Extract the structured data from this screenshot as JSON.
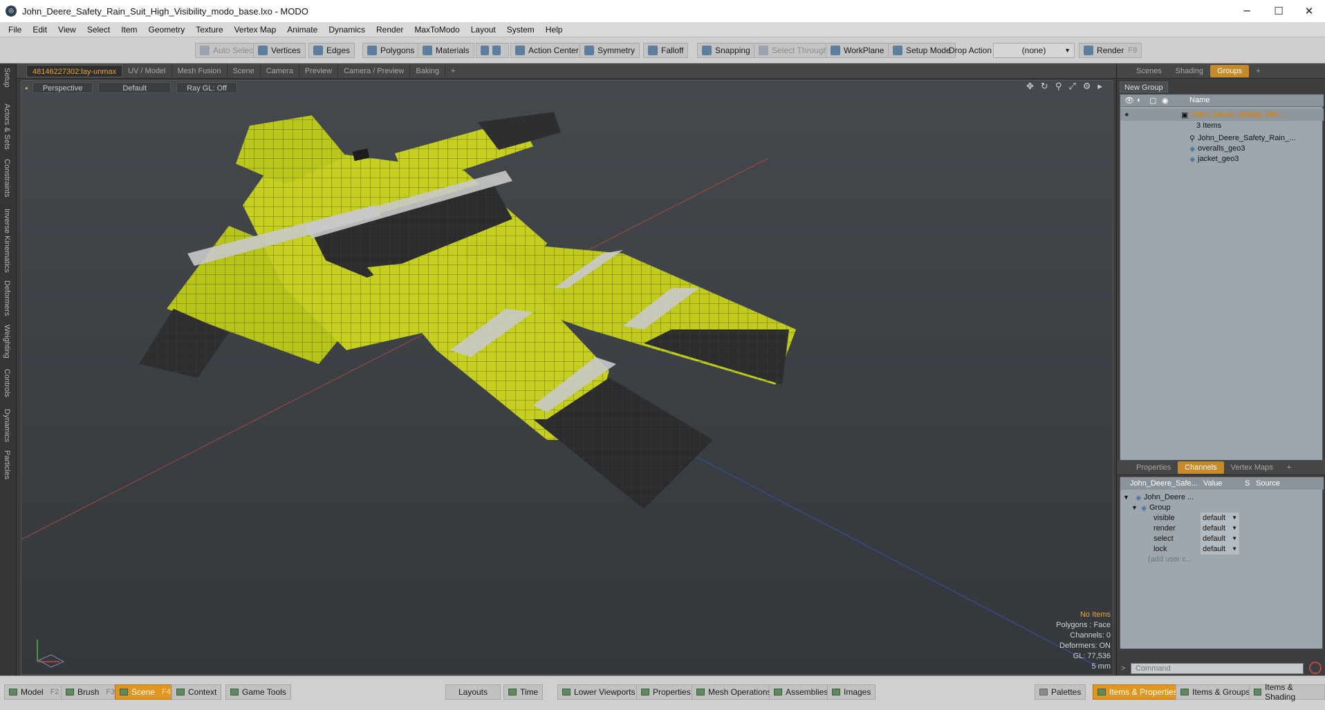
{
  "window": {
    "title": "John_Deere_Safety_Rain_Suit_High_Visibility_modo_base.lxo - MODO"
  },
  "menu": [
    "File",
    "Edit",
    "View",
    "Select",
    "Item",
    "Geometry",
    "Texture",
    "Vertex Map",
    "Animate",
    "Dynamics",
    "Render",
    "MaxToModo",
    "Layout",
    "System",
    "Help"
  ],
  "toolbar": {
    "auto_select": "Auto Select",
    "vertices": "Vertices",
    "edges": "Edges",
    "polygons": "Polygons",
    "materials": "Materials",
    "action_center": "Action Center",
    "symmetry": "Symmetry",
    "falloff": "Falloff",
    "snapping": "Snapping",
    "select_through": "Select Through",
    "workplane": "WorkPlane",
    "setup_mode": "Setup Mode",
    "drop_action_label": "Drop Action",
    "drop_action_value": "(none)",
    "render": "Render",
    "render_key": "F9"
  },
  "left_tabs": [
    "Setup",
    "Actors & Sets",
    "Constraints",
    "Inverse Kinematics",
    "Deformers",
    "Weighting",
    "Controls",
    "Dynamics",
    "Particles"
  ],
  "viewport_tabs": [
    "48146227302:lay-unmax",
    "UV / Model",
    "Mesh Fusion",
    "Scene",
    "Camera",
    "Preview",
    "Camera / Preview",
    "Baking",
    "+"
  ],
  "viewport": {
    "view_mode": "Perspective",
    "shading": "Default",
    "raygl": "Ray GL: Off",
    "info": {
      "items": "No Items",
      "polygons": "Polygons : Face",
      "channels": "Channels: 0",
      "deformers": "Deformers: ON",
      "gl": "GL: 77,536",
      "scale": "5 mm"
    }
  },
  "right_top_tabs": [
    "Scenes",
    "Shading",
    "Groups",
    "+"
  ],
  "groups": {
    "new_group": "New Group",
    "name_header": "Name",
    "root": "John_Deere_Safety_Rai ...",
    "count": "3 Items",
    "children": [
      "John_Deere_Safety_Rain_...",
      "overalls_geo3",
      "jacket_geo3"
    ]
  },
  "right_bottom_tabs": [
    "Properties",
    "Channels",
    "Vertex Maps",
    "+"
  ],
  "channels": {
    "headers": {
      "name": "John_Deere_Safe...",
      "value": "Value",
      "s": "S",
      "source": "Source"
    },
    "root": "John_Deere ...",
    "group": "Group",
    "rows": [
      {
        "name": "visible",
        "value": "default"
      },
      {
        "name": "render",
        "value": "default"
      },
      {
        "name": "select",
        "value": "default"
      },
      {
        "name": "lock",
        "value": "default"
      }
    ],
    "add_user": "(add user c..."
  },
  "command": {
    "placeholder": "Command"
  },
  "bottom": {
    "model": "Model",
    "model_key": "F2",
    "brush": "Brush",
    "brush_key": "F3",
    "scene": "Scene",
    "scene_key": "F4",
    "context": "Context",
    "game_tools": "Game Tools",
    "layouts": "Layouts",
    "time": "Time",
    "lower_viewports": "Lower Viewports",
    "properties": "Properties",
    "mesh_operations": "Mesh Operations",
    "assemblies": "Assemblies",
    "images": "Images",
    "palettes": "Palettes",
    "items_properties": "Items & Properties",
    "items_groups": "Items & Groups",
    "items_shading": "Items & Shading"
  }
}
